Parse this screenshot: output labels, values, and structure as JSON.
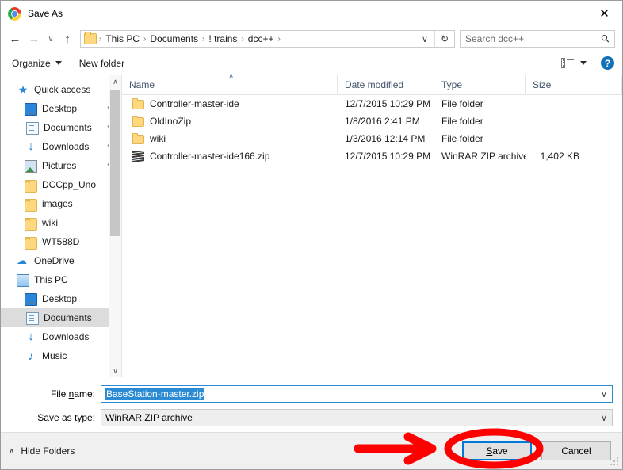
{
  "window": {
    "title": "Save As",
    "app_icon": "chrome-icon",
    "close_label": "✕"
  },
  "address": {
    "back_icon": "←",
    "forward_icon": "→",
    "recent_icon": "∨",
    "up_icon": "↑",
    "breadcrumbs": [
      "This PC",
      "Documents",
      "! trains",
      "dcc++"
    ],
    "separator": "›",
    "dropdown_icon": "∨",
    "refresh_icon": "↻"
  },
  "search": {
    "placeholder": "Search dcc++",
    "icon": "⚲"
  },
  "toolbar": {
    "organize_label": "Organize",
    "new_folder_label": "New folder",
    "view_icon": "view-mode-icon",
    "help_label": "?"
  },
  "sidebar": {
    "items": [
      {
        "label": "Quick access",
        "icon": "star-icon",
        "level": 0,
        "pinned": false,
        "selected": false
      },
      {
        "label": "Desktop",
        "icon": "monitor-icon",
        "level": 1,
        "pinned": true,
        "selected": false
      },
      {
        "label": "Documents",
        "icon": "document-icon",
        "level": 1,
        "pinned": true,
        "selected": false
      },
      {
        "label": "Downloads",
        "icon": "download-icon",
        "level": 1,
        "pinned": true,
        "selected": false
      },
      {
        "label": "Pictures",
        "icon": "picture-icon",
        "level": 1,
        "pinned": true,
        "selected": false
      },
      {
        "label": "DCCpp_Uno",
        "icon": "folder-icon",
        "level": 1,
        "pinned": false,
        "selected": false
      },
      {
        "label": "images",
        "icon": "folder-icon",
        "level": 1,
        "pinned": false,
        "selected": false
      },
      {
        "label": "wiki",
        "icon": "folder-icon",
        "level": 1,
        "pinned": false,
        "selected": false
      },
      {
        "label": "WT588D",
        "icon": "folder-icon",
        "level": 1,
        "pinned": false,
        "selected": false
      },
      {
        "label": "OneDrive",
        "icon": "cloud-icon",
        "level": 0,
        "pinned": false,
        "selected": false
      },
      {
        "label": "This PC",
        "icon": "pc-icon",
        "level": 0,
        "pinned": false,
        "selected": false
      },
      {
        "label": "Desktop",
        "icon": "monitor-icon",
        "level": 1,
        "pinned": false,
        "selected": false
      },
      {
        "label": "Documents",
        "icon": "document-icon",
        "level": 1,
        "pinned": false,
        "selected": true
      },
      {
        "label": "Downloads",
        "icon": "download-icon",
        "level": 1,
        "pinned": false,
        "selected": false
      },
      {
        "label": "Music",
        "icon": "music-icon",
        "level": 1,
        "pinned": false,
        "selected": false
      }
    ],
    "pin_icon": "📌",
    "scroll_up_icon": "∧",
    "scroll_down_icon": "∨"
  },
  "filelist": {
    "columns": [
      "Name",
      "Date modified",
      "Type",
      "Size"
    ],
    "sort_indicator": "∧",
    "rows": [
      {
        "name": "Controller-master-ide",
        "date": "12/7/2015 10:29 PM",
        "type": "File folder",
        "size": "",
        "icon": "folder-icon"
      },
      {
        "name": "OldInoZip",
        "date": "1/8/2016 2:41 PM",
        "type": "File folder",
        "size": "",
        "icon": "folder-icon"
      },
      {
        "name": "wiki",
        "date": "1/3/2016 12:14 PM",
        "type": "File folder",
        "size": "",
        "icon": "folder-icon"
      },
      {
        "name": "Controller-master-ide166.zip",
        "date": "12/7/2015 10:29 PM",
        "type": "WinRAR ZIP archive",
        "size": "1,402 KB",
        "icon": "winrar-archive-icon"
      }
    ]
  },
  "form": {
    "filename_label_pre": "File ",
    "filename_label_accel": "n",
    "filename_label_post": "ame:",
    "filename_value": "BaseStation-master.zip",
    "filetype_label_pre": "Save as t",
    "filetype_label_accel": "y",
    "filetype_label_post": "pe:",
    "filetype_value": "WinRAR ZIP archive",
    "dropdown_icon": "∨"
  },
  "footer": {
    "hide_folders_label": "Hide Folders",
    "hide_folders_icon": "∧",
    "save_label_pre": "",
    "save_label_accel": "S",
    "save_label_post": "ave",
    "save_label": "Save",
    "cancel_label": "Cancel"
  },
  "annotations": {
    "arrow_color": "#FF0000",
    "circle_color": "#FF0000",
    "description": "red hand-drawn arrow pointing to circled Save button"
  },
  "colors": {
    "accent": "#0078d7",
    "selection": "#2a8ad4",
    "folder": "#fdd87f",
    "annotation_red": "#FF0000"
  }
}
